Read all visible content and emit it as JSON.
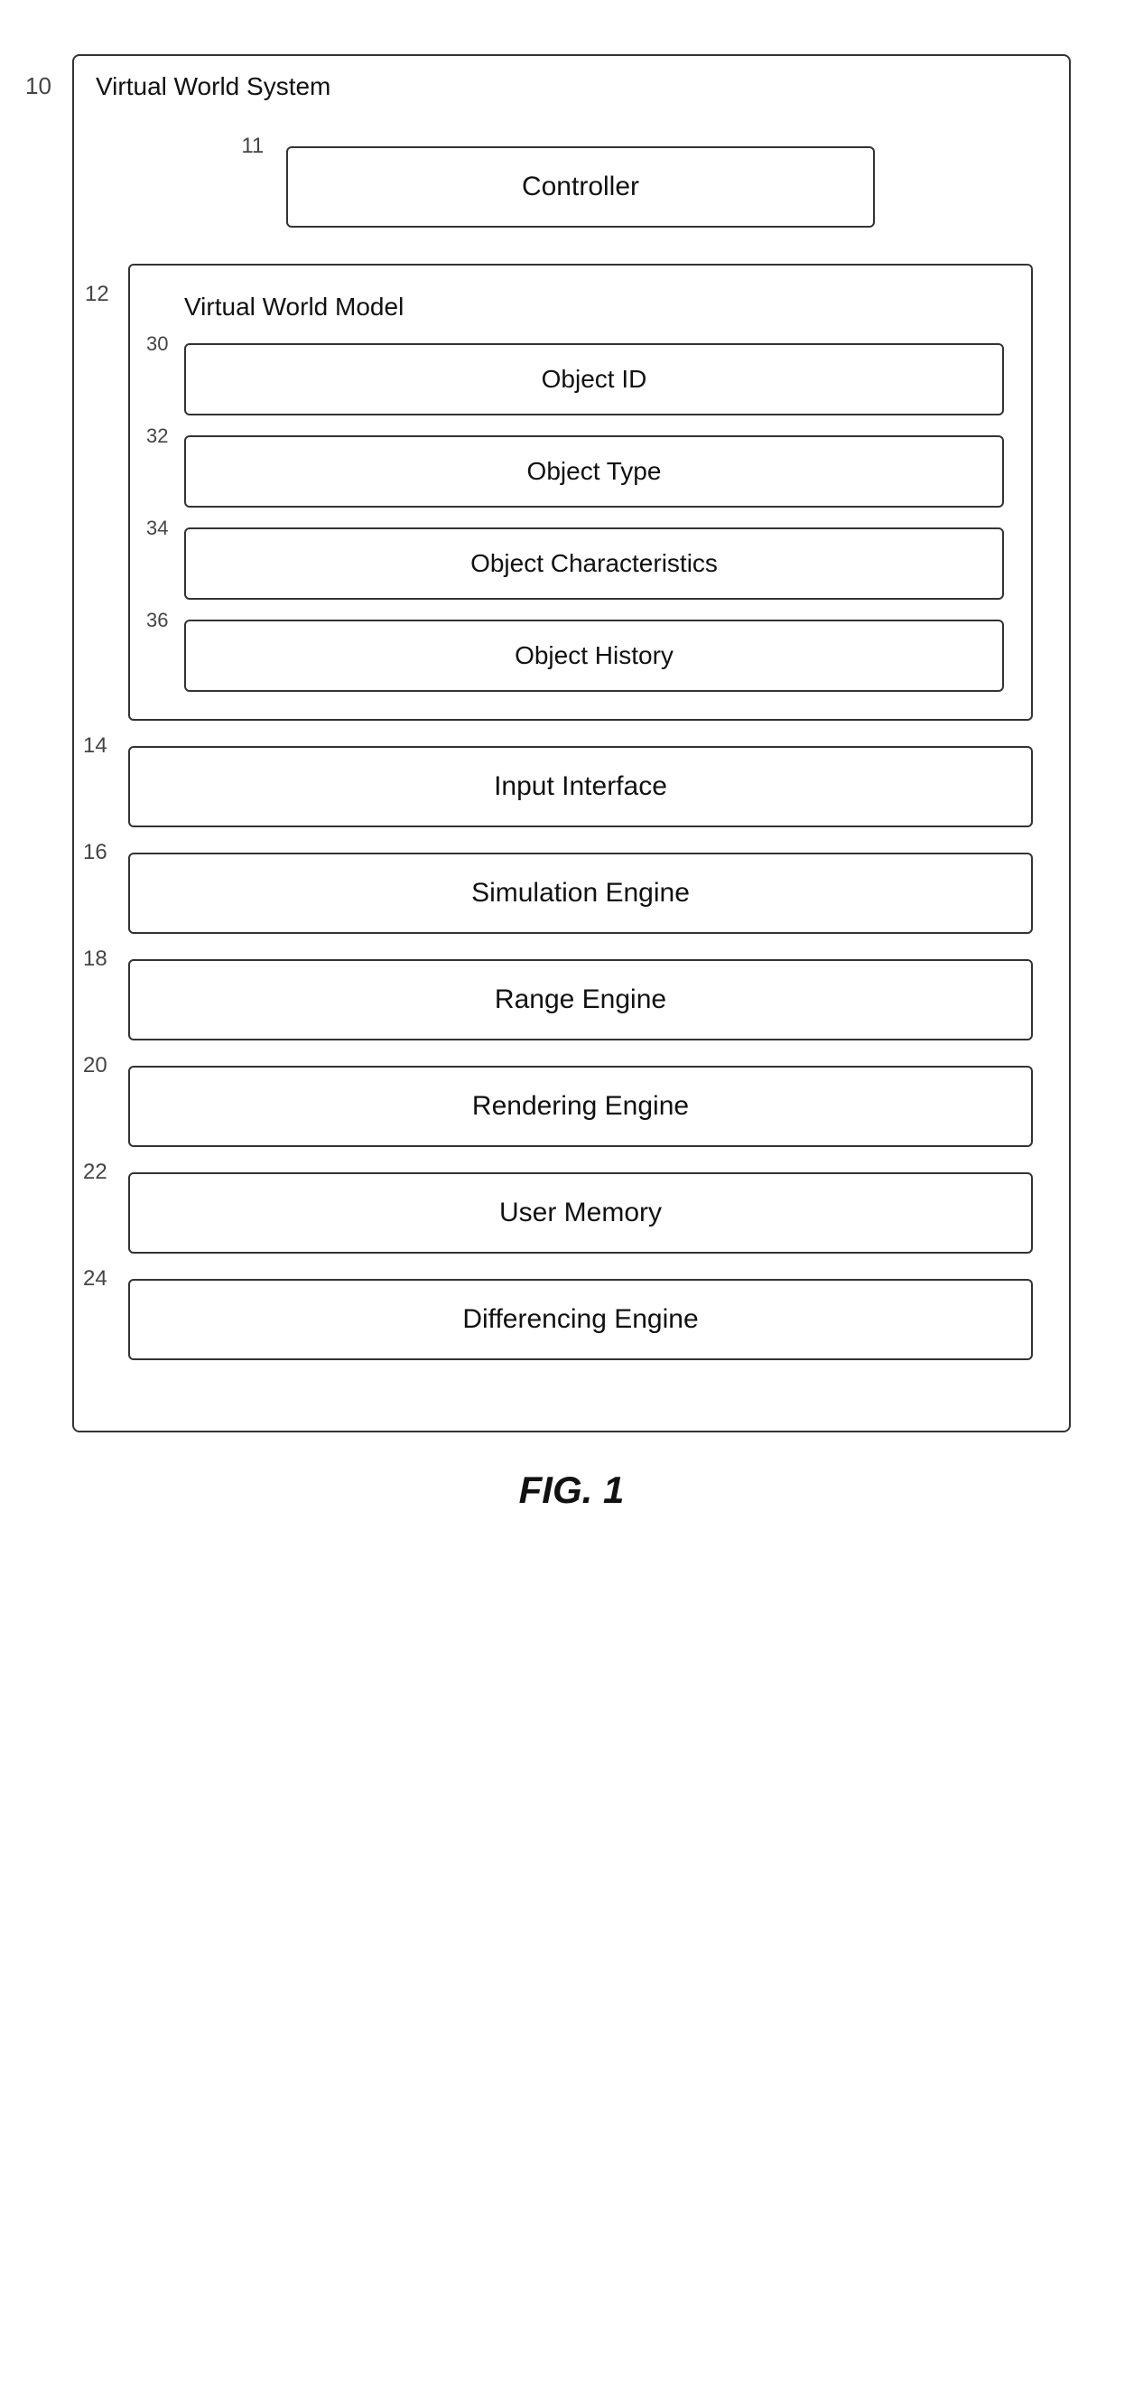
{
  "diagram": {
    "outer_title": "Virtual World System",
    "outer_ref": "10",
    "fig_label": "FIG. 1",
    "controller": {
      "label": "Controller",
      "ref": "11"
    },
    "virtual_world_model": {
      "label": "Virtual World Model",
      "ref": "12",
      "components": [
        {
          "label": "Object ID",
          "ref": "30"
        },
        {
          "label": "Object Type",
          "ref": "32"
        },
        {
          "label": "Object Characteristics",
          "ref": "34"
        },
        {
          "label": "Object History",
          "ref": "36"
        }
      ]
    },
    "main_components": [
      {
        "label": "Input Interface",
        "ref": "14"
      },
      {
        "label": "Simulation Engine",
        "ref": "16"
      },
      {
        "label": "Range Engine",
        "ref": "18"
      },
      {
        "label": "Rendering Engine",
        "ref": "20"
      },
      {
        "label": "User Memory",
        "ref": "22"
      },
      {
        "label": "Differencing Engine",
        "ref": "24"
      }
    ]
  }
}
